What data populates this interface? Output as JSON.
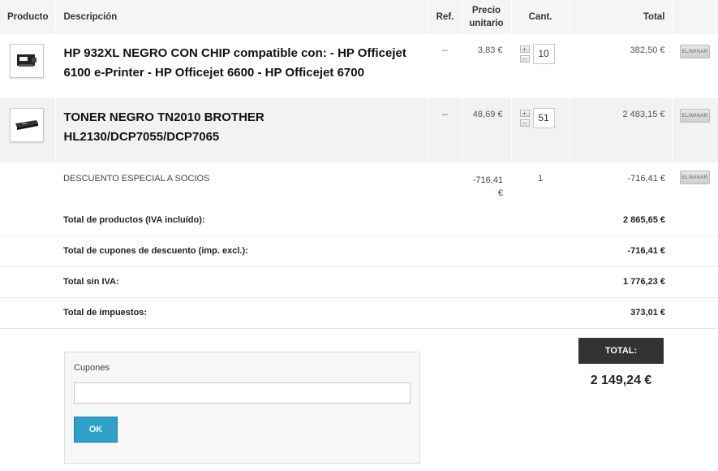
{
  "headers": {
    "product": "Producto",
    "description": "Descripción",
    "ref": "Ref.",
    "unit_price_line1": "Precio",
    "unit_price_line2": "unitario",
    "qty": "Cant.",
    "total": "Total"
  },
  "items": [
    {
      "icon": "ink-cartridge-icon",
      "name": "HP 932XL NEGRO CON CHIP compatible con: - HP Officejet 6100 e-Printer - HP Officejet 6600 - HP Officejet 6700",
      "ref": "--",
      "unit_price": "3,83 €",
      "qty": "10",
      "total": "382,50 €",
      "delete_label": "ELIMINAR"
    },
    {
      "icon": "toner-cartridge-icon",
      "name": "TONER NEGRO TN2010 BROTHER HL2130/DCP7055/DCP7065",
      "ref": "--",
      "unit_price": "48,69 €",
      "qty": "51",
      "total": "2 483,15 €",
      "delete_label": "ELIMINAR"
    }
  ],
  "discount": {
    "name": "DESCUENTO ESPECIAL A SOCIOS",
    "unit_price_line1": "-716,41",
    "unit_price_line2": "€",
    "qty": "1",
    "total": "-716,41 €",
    "delete_label": "ELIMINAR"
  },
  "totals": [
    {
      "label": "Total de productos (IVA incluído):",
      "value": "2 865,65 €"
    },
    {
      "label": "Total de cupones de descuento (imp. excl.):",
      "value": "-716,41 €"
    },
    {
      "label": "Total sin IVA:",
      "value": "1 776,23 €"
    },
    {
      "label": "Total de impuestos:",
      "value": "373,01 €"
    }
  ],
  "coupons": {
    "label": "Cupones",
    "input_value": "",
    "button_label": "OK"
  },
  "grand_total": {
    "label": "TOTAL:",
    "value": "2 149,24 €"
  },
  "qty_controls": {
    "plus": "+",
    "minus": "−"
  },
  "colors": {
    "accent_button": "#2da1c9",
    "total_box": "#333333",
    "header_bg": "#f5f5f5",
    "alt_row_bg": "#f2f2f2"
  }
}
